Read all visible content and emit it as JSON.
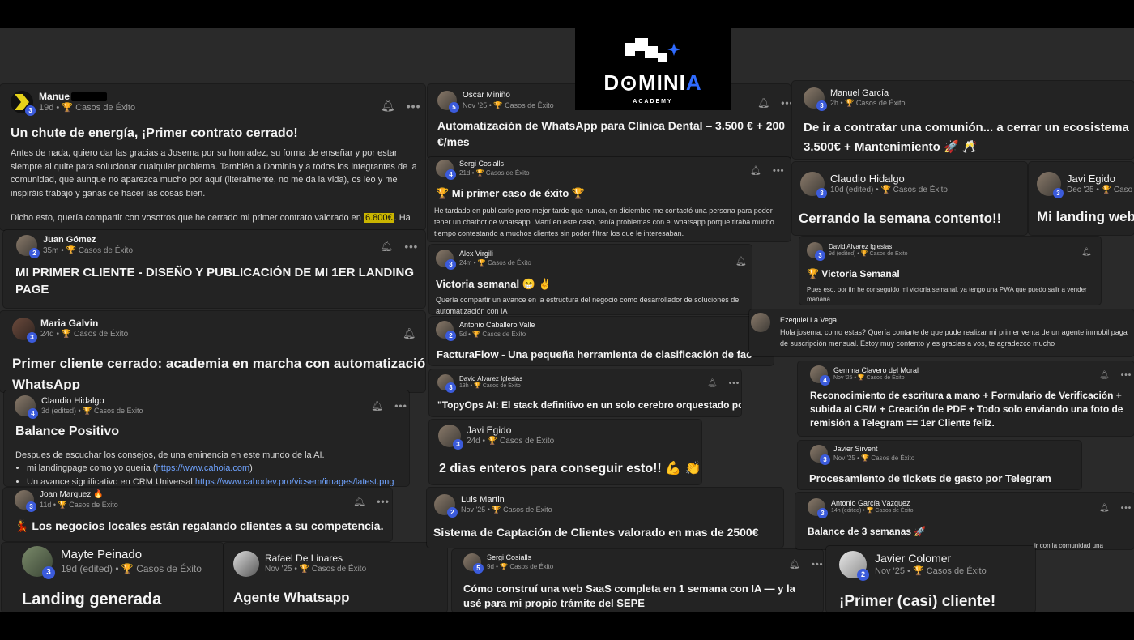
{
  "logo": {
    "word_a": "D",
    "word_b": "MINI",
    "word_c": "A",
    "subtitle": "ACADEMY"
  },
  "category": "Casos de Éxito",
  "posts": {
    "manuel": {
      "name": "Manue",
      "meta": "19d •",
      "level": "3",
      "title": "Un chute de energía, ¡Primer contrato cerrado!",
      "p1": "Antes de nada, quiero dar las gracias a Josema por su honradez, su forma de enseñar y por estar siempre al quite para solucionar cualquier problema. También a Dominia y a todos los integrantes de la comunidad, que aunque no aparezca mucho por aquí (literalmente, no me da la vida), os leo y me inspiráis trabajo y ganas de hacer las cosas bien.",
      "p2a": "Dicho esto, quería compartir con vosotros que he cerrado mi primer contrato valorado en ",
      "p2hl": "6.800€",
      "p2b": ". Ha"
    },
    "juan": {
      "name": "Juan Gómez",
      "meta": "35m •",
      "level": "2",
      "title": "MI PRIMER CLIENTE - DISEÑO Y PUBLICACIÓN DE MI 1ER LANDING PAGE"
    },
    "maria": {
      "name": "Maria Galvin",
      "meta": "24d •",
      "level": "3",
      "title": "Primer cliente cerrado: academia en marcha con automatización p WhatsApp"
    },
    "claudio1": {
      "name": "Claudio Hidalgo",
      "meta": "3d (edited) •",
      "level": "4",
      "title": "Balance Positivo",
      "body": "Despues de escuchar los consejos, de una eminencia en este mundo de la AI.",
      "li1a": "mi landingpage como yo queria (",
      "li1link": "https://www.cahoia.com",
      "li1b": ")",
      "li2a": "Un avance significativo en CRM Universal ",
      "li2link": "https://www.cahodev.pro/vicsem/images/latest.png"
    },
    "joan": {
      "name": "Joan Marquez 🔥",
      "meta": "11d •",
      "level": "3",
      "title": "💃 Los negocios locales están regalando clientes a su competencia."
    },
    "mayte": {
      "name": "Mayte Peinado",
      "meta": "19d (edited) •",
      "level": "3",
      "title": "Landing generada"
    },
    "rafael": {
      "name": "Rafael De Linares",
      "meta": "Nov '25 •",
      "level": "",
      "title": "Agente Whatsapp"
    },
    "oscar": {
      "name": "Oscar Miniño",
      "meta": "Nov '25 •",
      "level": "5",
      "title": "Automatización de WhatsApp para Clínica Dental – 3.500 € + 200 €/mes"
    },
    "sergi1": {
      "name": "Sergi Cosialls",
      "meta": "21d •",
      "level": "4",
      "title": "🏆 Mi primer caso de éxito 🏆",
      "body": "He tardado en publicarlo pero mejor tarde que nunca, en diciembre me contactó una persona para poder tener un chatbot de whatsapp. Martí en este caso, tenía problemas con el whatsapp porque tiraba mucho tiempo contestando a muchos clientes sin poder filtrar los que le interesaban."
    },
    "alex": {
      "name": "Alex Virgili",
      "meta": "24m •",
      "level": "3",
      "title": "Victoria semanal 😁 ✌",
      "body": "Quería compartir un avance en la estructura del negocio como desarrollador de soluciones de automatización con IA"
    },
    "antonio1": {
      "name": "Antonio Caballero Valle",
      "meta": "5d •",
      "level": "2",
      "title": "FacturaFlow - Una pequeña herramienta de clasificación de fac"
    },
    "david1": {
      "name": "David Alvarez Iglesias",
      "meta": "13h •",
      "level": "3",
      "title": "\"TopyOps AI: El stack definitivo en un solo cerebro orquestado por IA"
    },
    "javi1": {
      "name": "Javi Egido",
      "meta": "24d •",
      "level": "3",
      "title": "2 dias enteros para conseguir esto!! 💪 👏"
    },
    "luis": {
      "name": "Luis Martin",
      "meta": "Nov '25 •",
      "level": "2",
      "title": "Sistema de Captación de Clientes valorado en mas de 2500€"
    },
    "sergi2": {
      "name": "Sergi Cosialls",
      "meta": "9d •",
      "level": "5",
      "title": "Cómo construí una web SaaS completa en 1 semana con IA — y la usé para mi propio trámite del SEPE"
    },
    "manuelg": {
      "name": "Manuel García",
      "meta": "2h •",
      "level": "3",
      "title": "De ir a contratar una comunión... a cerrar un ecosistema 3.500€ + Mantenimiento 🚀 🥂"
    },
    "claudio2": {
      "name": "Claudio Hidalgo",
      "meta": "10d (edited) •",
      "level": "3",
      "title": "Cerrando la semana contento!!"
    },
    "javi2": {
      "name": "Javi Egido",
      "meta": "Dec '25 •",
      "level": "3",
      "title": "Mi landing web",
      "cat": "Caso"
    },
    "david2": {
      "name": "David Alvarez Iglesias",
      "meta": "9d (edited) •",
      "level": "3",
      "title": "🏆 Victoria Semanal",
      "body": "Pues eso, por fin he conseguido mi victoria semanal, ya tengo una PWA que puedo salir a vender mañana"
    },
    "ezequiel": {
      "name": "Ezequiel La Vega",
      "body": "Hola josema, como estas? Quería contarte de que pude realizar mi primer venta de un agente inmobil paga de suscripción mensual. Estoy muy contento y es gracias a vos, te agradezco mucho"
    },
    "gemma": {
      "name": "Gemma Clavero del Moral",
      "meta": "Nov '25 •",
      "level": "4",
      "title": "Reconocimiento de escritura a mano + Formulario de Verificación + subida al CRM + Creación de PDF + Todo solo enviando una foto de remisión a Telegram == 1er Cliente feliz."
    },
    "javier_s": {
      "name": "Javier Sirvent",
      "meta": "Nov '25 •",
      "level": "3",
      "title": "Procesamiento de tickets de gasto por Telegram"
    },
    "antonio2": {
      "name": "Antonio García Vázquez",
      "meta": "14h (edited) •",
      "level": "3",
      "title": "Balance de 3 semanas 🚀",
      "tail": "ir con la comunidad una"
    },
    "javier_c": {
      "name": "Javier Colomer",
      "meta": "Nov '25 •",
      "level": "2",
      "title": "¡Primer (casi) cliente!"
    }
  },
  "icons": {
    "bell": "bell-icon",
    "more": "more-icon",
    "trophy": "trophy-icon"
  }
}
